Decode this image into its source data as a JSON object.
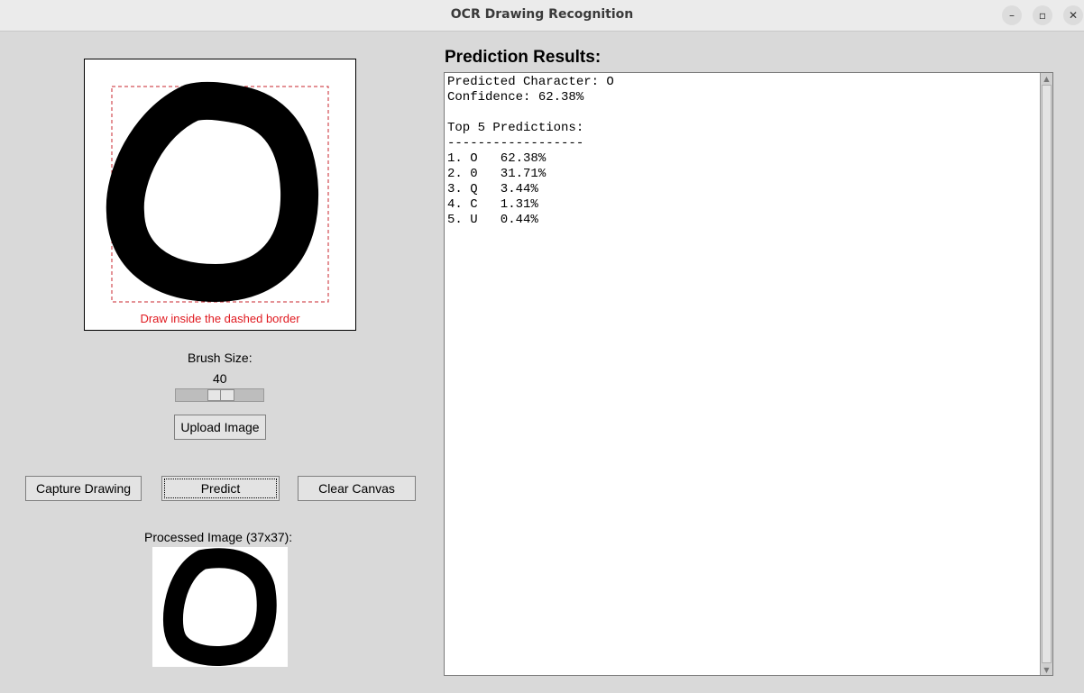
{
  "window": {
    "title": "OCR Drawing Recognition",
    "min_glyph": "–",
    "max_glyph": "▫",
    "close_glyph": "✕"
  },
  "canvas": {
    "hint": "Draw inside the dashed border",
    "hint_color": "#e0191f"
  },
  "brush": {
    "label": "Brush Size:",
    "value": "40"
  },
  "buttons": {
    "upload": "Upload Image",
    "capture": "Capture Drawing",
    "predict": "Predict",
    "clear": "Clear Canvas"
  },
  "processed": {
    "label": "Processed Image (37x37):"
  },
  "results": {
    "title": "Prediction Results:",
    "text": "Predicted Character: O\nConfidence: 62.38%\n\nTop 5 Predictions:\n------------------\n1. O   62.38%\n2. 0   31.71%\n3. Q   3.44%\n4. C   1.31%\n5. U   0.44%",
    "scroll_up_glyph": "▲",
    "scroll_down_glyph": "▼"
  }
}
